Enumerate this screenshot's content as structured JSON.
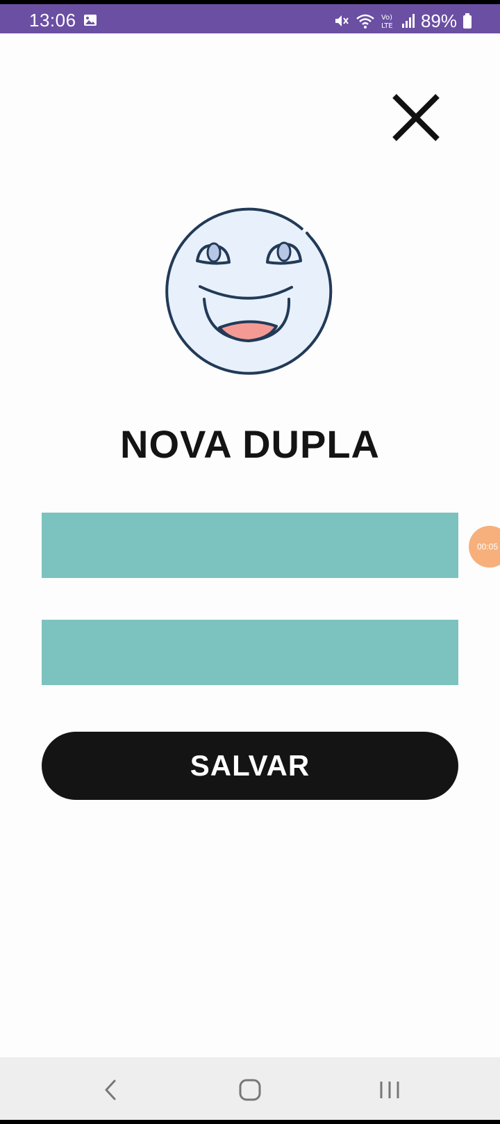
{
  "status_bar": {
    "time": "13:06",
    "battery": "89%",
    "icons": [
      "gallery-icon",
      "mute-icon",
      "wifi-icon",
      "volte-icon",
      "signal-icon",
      "battery-icon"
    ],
    "background_color": "#6b4fa3"
  },
  "header": {
    "close_icon": "close-icon"
  },
  "mascot": {
    "icon": "smiling-face-icon",
    "fill_color": "#e8f0fb",
    "stroke_color": "#213a57",
    "mouth_color": "#f49a95"
  },
  "page": {
    "title": "NOVA DUPLA"
  },
  "form": {
    "field_color": "#7cc2bf",
    "first_field_value": "",
    "second_field_value": "",
    "save_label": "SALVAR"
  },
  "overlay": {
    "timer_text": "00:05"
  },
  "nav_bar": {
    "icons": [
      "back-icon",
      "home-icon",
      "recents-icon"
    ]
  }
}
